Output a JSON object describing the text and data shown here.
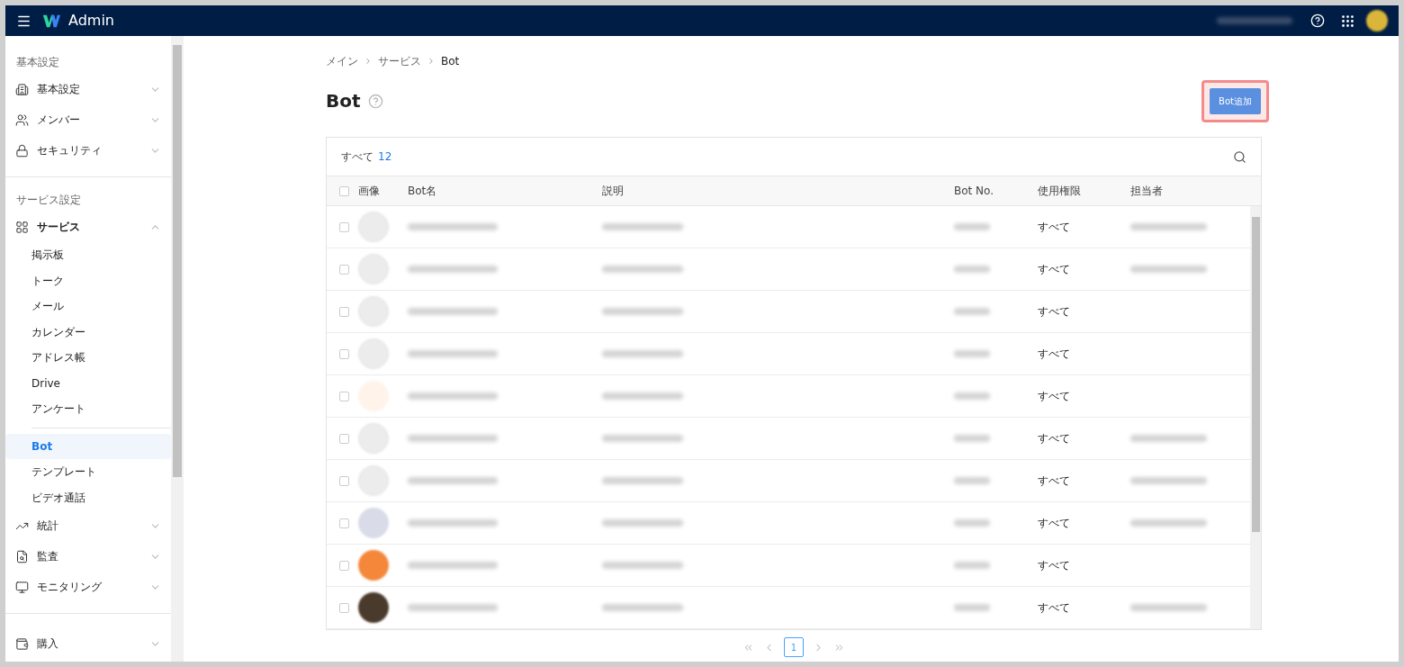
{
  "header": {
    "title": "Admin"
  },
  "sidebar": {
    "sections": [
      {
        "heading": "基本設定",
        "items": [
          {
            "label": "基本設定",
            "expanded": false
          },
          {
            "label": "メンバー",
            "expanded": false
          },
          {
            "label": "セキュリティ",
            "expanded": false
          }
        ]
      },
      {
        "heading": "サービス設定",
        "items": [
          {
            "label": "サービス",
            "expanded": true,
            "groups": [
              [
                {
                  "label": "掲示板",
                  "selected": false
                },
                {
                  "label": "トーク",
                  "selected": false
                },
                {
                  "label": "メール",
                  "selected": false
                },
                {
                  "label": "カレンダー",
                  "selected": false
                },
                {
                  "label": "アドレス帳",
                  "selected": false
                },
                {
                  "label": "Drive",
                  "selected": false
                },
                {
                  "label": "アンケート",
                  "selected": false
                }
              ],
              [
                {
                  "label": "Bot",
                  "selected": true
                },
                {
                  "label": "テンプレート",
                  "selected": false
                },
                {
                  "label": "ビデオ通話",
                  "selected": false
                }
              ]
            ]
          },
          {
            "label": "統計",
            "expanded": false
          },
          {
            "label": "監査",
            "expanded": false
          },
          {
            "label": "モニタリング",
            "expanded": false
          }
        ]
      },
      {
        "items": [
          {
            "label": "購入",
            "expanded": false
          }
        ]
      }
    ]
  },
  "breadcrumb": [
    "メイン",
    "サービス",
    "Bot"
  ],
  "page_title": "Bot",
  "add_button": "Bot追加",
  "table": {
    "total_label": "すべて",
    "total_count": "12",
    "all_checked": false,
    "columns": [
      "画像",
      "Bot名",
      "説明",
      "Bot No.",
      "使用権限",
      "担当者"
    ],
    "rows": [
      {
        "checked": false,
        "permission": "すべて",
        "owner_shown": true
      },
      {
        "checked": false,
        "permission": "すべて",
        "owner_shown": true
      },
      {
        "checked": false,
        "permission": "すべて",
        "owner_shown": false
      },
      {
        "checked": false,
        "permission": "すべて",
        "owner_shown": false
      },
      {
        "checked": false,
        "permission": "すべて",
        "owner_shown": false
      },
      {
        "checked": false,
        "permission": "すべて",
        "owner_shown": true
      },
      {
        "checked": false,
        "permission": "すべて",
        "owner_shown": true
      },
      {
        "checked": false,
        "permission": "すべて",
        "owner_shown": true
      },
      {
        "checked": false,
        "permission": "すべて",
        "owner_shown": false
      },
      {
        "checked": false,
        "permission": "すべて",
        "owner_shown": true
      }
    ]
  },
  "pagination": {
    "pages": [
      {
        "label": "1",
        "selected": true
      }
    ]
  }
}
